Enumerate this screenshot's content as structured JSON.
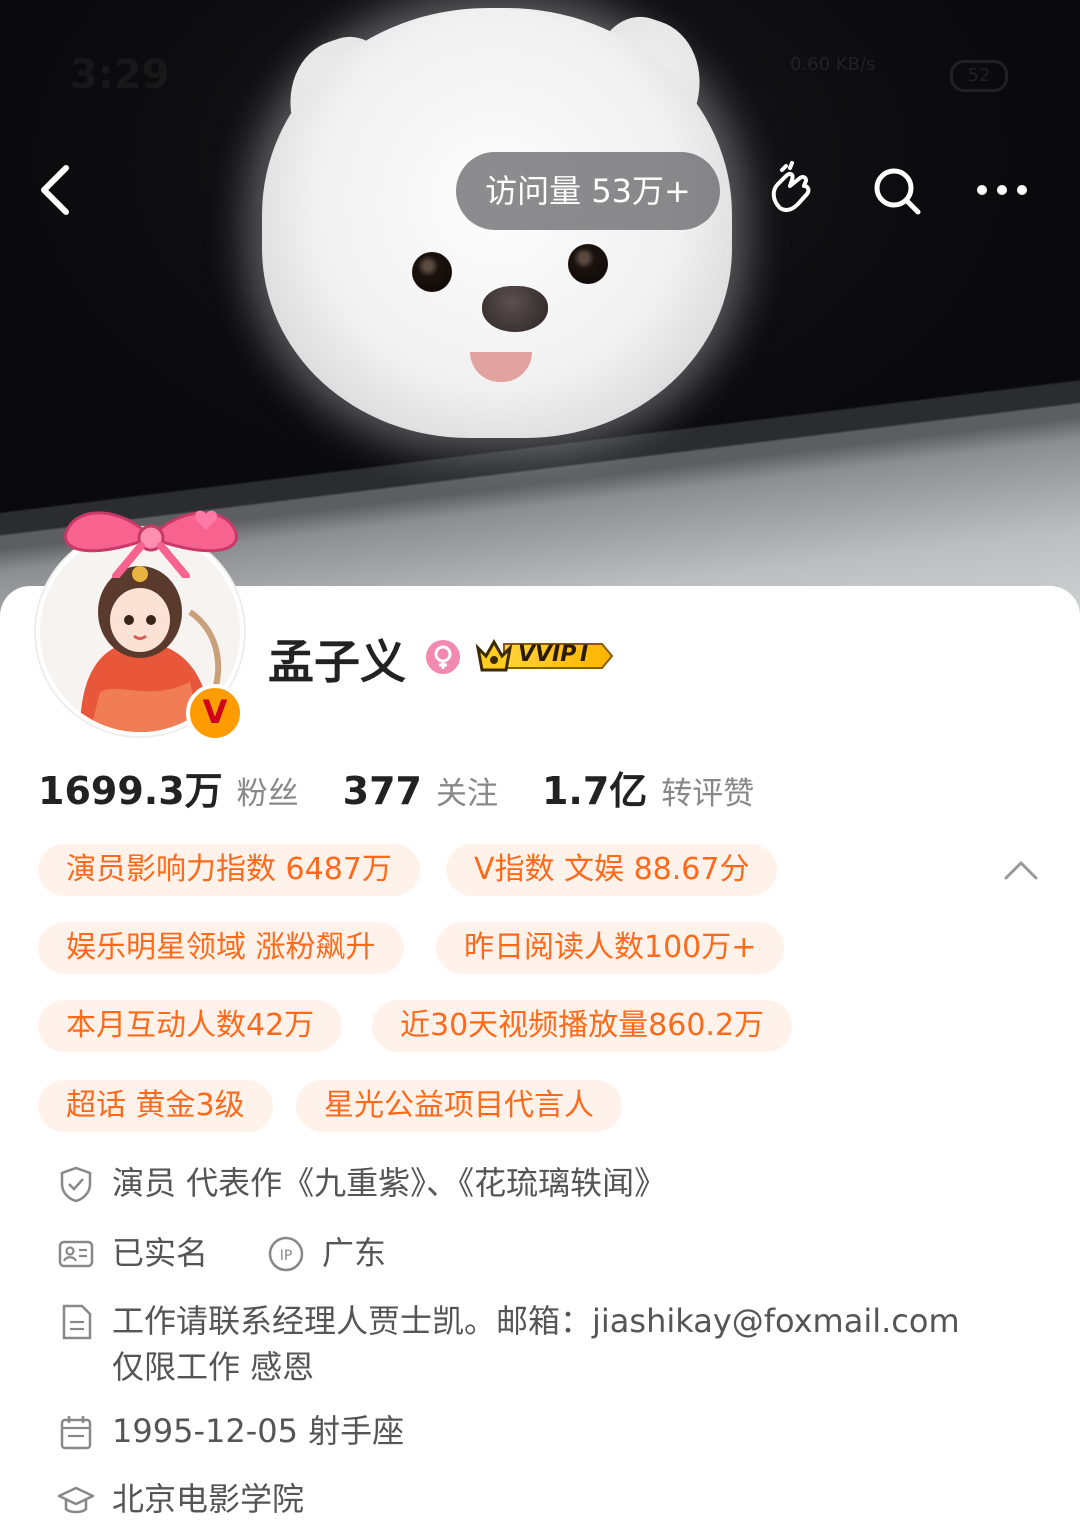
{
  "status_bar": {
    "time": "3:29",
    "network_speed": "0.60 KB/s",
    "battery": "52"
  },
  "header": {
    "visits_label": "访问量 53万+"
  },
  "icons": {
    "back": "chevron-left-icon",
    "hand": "finger-heart-icon",
    "search": "search-icon",
    "more": "more-dots-icon"
  },
  "profile": {
    "name": "孟子义",
    "vvip_label": "VVIP",
    "vvip_level": "I",
    "verified_mark": "V"
  },
  "stats": [
    {
      "value": "1699.3万",
      "label": "粉丝"
    },
    {
      "value": "377",
      "label": "关注"
    },
    {
      "value": "1.7亿",
      "label": "转评赞"
    }
  ],
  "tags": [
    "演员影响力指数 6487万",
    "V指数 文娱 88.67分",
    "娱乐明星领域 涨粉飙升",
    "昨日阅读人数100万+",
    "本月互动人数42万",
    "近30天视频播放量860.2万",
    "超话 黄金3级",
    "星光公益项目代言人"
  ],
  "info": {
    "verification": "演员 代表作《九重紫》、《花琉璃轶闻》",
    "real_name": "已实名",
    "ip_location": "广东",
    "bio_line1": "工作请联系经理人贾士凯。邮箱：jiashikay@foxmail.com",
    "bio_line2": "仅限工作 感恩",
    "birthday": "1995-12-05 射手座",
    "school": "北京电影学院"
  },
  "colors": {
    "tag_bg": "#fff2ea",
    "tag_text": "#ff6a1a",
    "badge_orange": "#ff9c00",
    "female_pink": "#f489b0"
  }
}
